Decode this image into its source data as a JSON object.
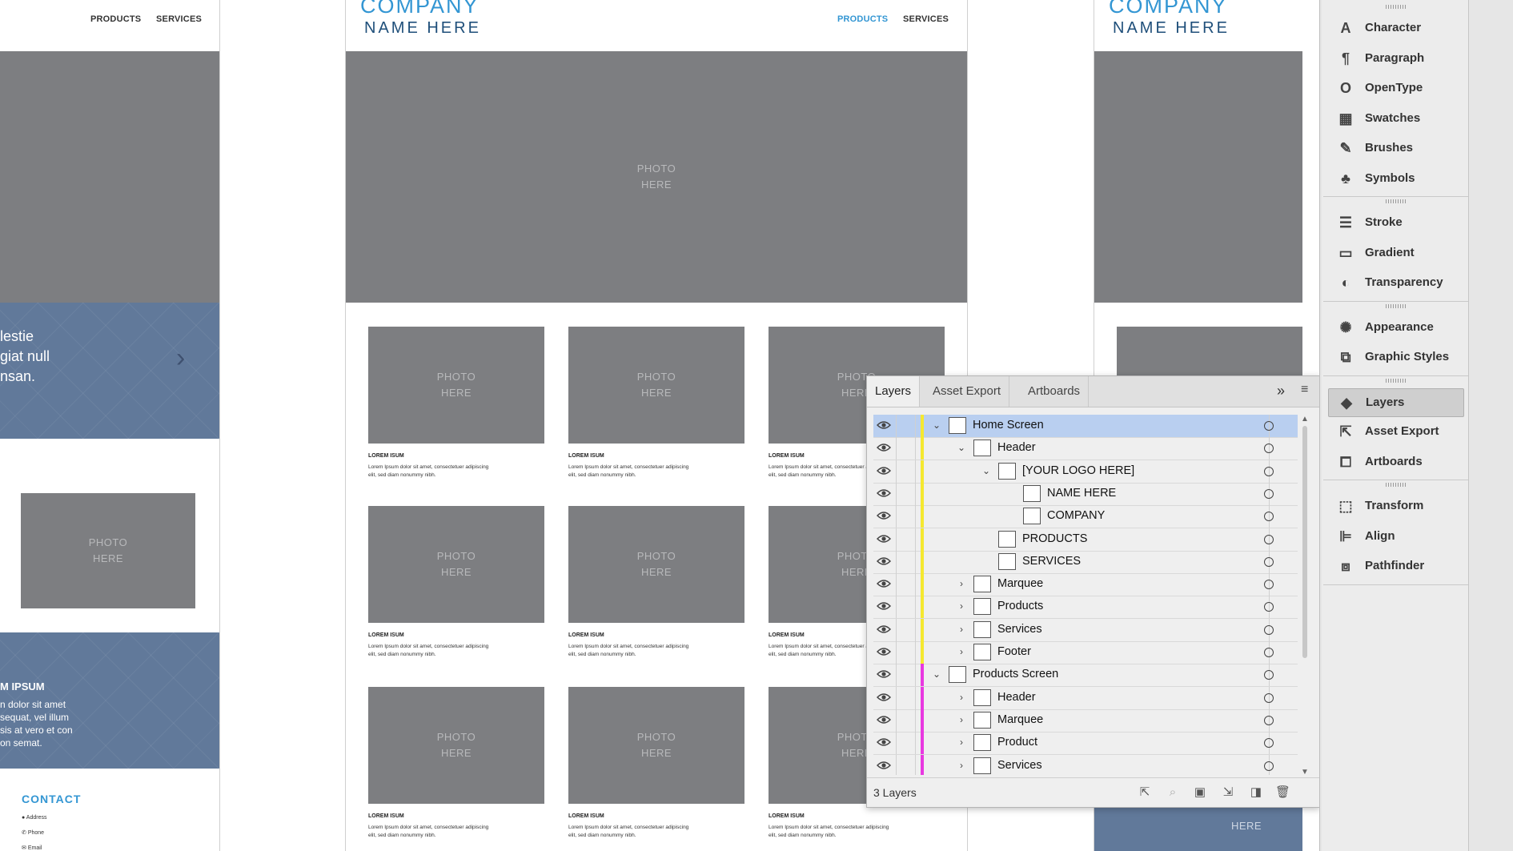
{
  "canvas": {
    "left_board": {
      "nav": [
        "PRODUCTS",
        "SERVICES"
      ],
      "hero_text": [
        "lestie",
        "giat null",
        "nsan."
      ],
      "photo": [
        "PHOTO",
        "HERE"
      ],
      "band2_title": "M IPSUM",
      "band2_text": [
        "n dolor sit amet",
        "sequat, vel illum",
        "sis at vero et con",
        "on semat."
      ],
      "contact_title": "CONTACT",
      "contact_items": [
        "Address",
        "Phone",
        "Email"
      ]
    },
    "center_board": {
      "company": "COMPANY",
      "name_here": "NAME HERE",
      "nav": [
        "PRODUCTS",
        "SERVICES"
      ],
      "hero_photo": [
        "PHOTO",
        "HERE"
      ],
      "tile_photo": [
        "PHOTO",
        "HERE"
      ],
      "lorem_title": "LOREM ISUM",
      "lorem_text": [
        "Lorem Ipsum dolor sit amet, consectetuer adipiscing",
        "elit, sed diam nonummy nibh."
      ]
    },
    "right_board": {
      "company": "COMPANY",
      "name_here": "NAME HERE",
      "photo_fragment": "HERE"
    }
  },
  "layers_panel": {
    "tabs": [
      "Layers",
      "Asset Export",
      "Artboards"
    ],
    "rows": [
      {
        "name": "Home Screen",
        "indent": 0,
        "twirl": "open",
        "color": "#f5e830",
        "selected": true
      },
      {
        "name": "Header",
        "indent": 1,
        "twirl": "open",
        "color": "#f5e830"
      },
      {
        "name": "[YOUR LOGO HERE]",
        "indent": 2,
        "twirl": "open",
        "color": "#f5e830"
      },
      {
        "name": "NAME HERE",
        "indent": 3,
        "twirl": "none",
        "color": "#f5e830"
      },
      {
        "name": "COMPANY",
        "indent": 3,
        "twirl": "none",
        "color": "#f5e830"
      },
      {
        "name": "PRODUCTS",
        "indent": 2,
        "twirl": "none",
        "color": "#f5e830"
      },
      {
        "name": "SERVICES",
        "indent": 2,
        "twirl": "none",
        "color": "#f5e830"
      },
      {
        "name": "Marquee",
        "indent": 1,
        "twirl": "closed",
        "color": "#f5e830"
      },
      {
        "name": "Products",
        "indent": 1,
        "twirl": "closed",
        "color": "#f5e830"
      },
      {
        "name": "Services",
        "indent": 1,
        "twirl": "closed",
        "color": "#f5e830"
      },
      {
        "name": "Footer",
        "indent": 1,
        "twirl": "closed",
        "color": "#f5e830"
      },
      {
        "name": "Products Screen",
        "indent": 0,
        "twirl": "open",
        "color": "#e838e0"
      },
      {
        "name": "Header",
        "indent": 1,
        "twirl": "closed",
        "color": "#e838e0"
      },
      {
        "name": "Marquee",
        "indent": 1,
        "twirl": "closed",
        "color": "#e838e0"
      },
      {
        "name": "Product",
        "indent": 1,
        "twirl": "closed",
        "color": "#e838e0"
      },
      {
        "name": "Services",
        "indent": 1,
        "twirl": "closed",
        "color": "#e838e0"
      }
    ],
    "layer_count": "3 Layers"
  },
  "dock": {
    "groups": [
      [
        "Character",
        "Paragraph",
        "OpenType",
        "Swatches",
        "Brushes",
        "Symbols"
      ],
      [
        "Stroke",
        "Gradient",
        "Transparency"
      ],
      [
        "Appearance",
        "Graphic Styles"
      ],
      [
        "Layers",
        "Asset Export",
        "Artboards"
      ],
      [
        "Transform",
        "Align",
        "Pathfinder"
      ]
    ],
    "active": "Layers"
  }
}
